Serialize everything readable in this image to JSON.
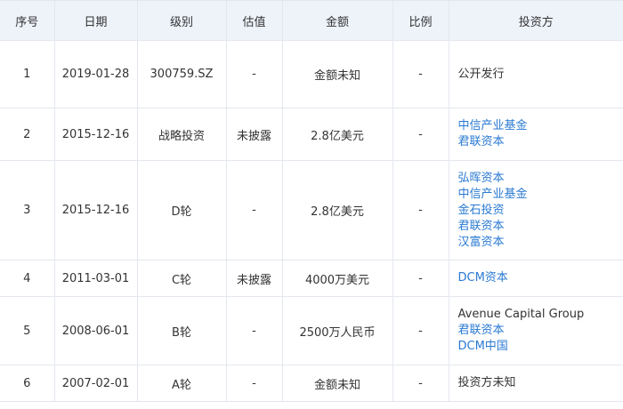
{
  "headers": [
    "序号",
    "日期",
    "级别",
    "估值",
    "金额",
    "比例",
    "投资方"
  ],
  "rows": [
    {
      "no": "1",
      "date": "2019-01-28",
      "level": "300759.SZ",
      "valuation": "-",
      "amount": "金额未知",
      "ratio": "-",
      "investors": [
        {
          "name": "公开发行",
          "link": false
        }
      ]
    },
    {
      "no": "2",
      "date": "2015-12-16",
      "level": "战略投资",
      "valuation": "未披露",
      "amount": "2.8亿美元",
      "ratio": "-",
      "investors": [
        {
          "name": "中信产业基金",
          "link": true
        },
        {
          "name": "君联资本",
          "link": true
        }
      ]
    },
    {
      "no": "3",
      "date": "2015-12-16",
      "level": "D轮",
      "valuation": "-",
      "amount": "2.8亿美元",
      "ratio": "-",
      "investors": [
        {
          "name": "弘晖资本",
          "link": true
        },
        {
          "name": "中信产业基金",
          "link": true
        },
        {
          "name": "金石投资",
          "link": true
        },
        {
          "name": "君联资本",
          "link": true
        },
        {
          "name": "汉富资本",
          "link": true
        }
      ]
    },
    {
      "no": "4",
      "date": "2011-03-01",
      "level": "C轮",
      "valuation": "未披露",
      "amount": "4000万美元",
      "ratio": "-",
      "investors": [
        {
          "name": "DCM资本",
          "link": true
        }
      ]
    },
    {
      "no": "5",
      "date": "2008-06-01",
      "level": "B轮",
      "valuation": "-",
      "amount": "2500万人民币",
      "ratio": "-",
      "investors": [
        {
          "name": "Avenue Capital Group",
          "link": false
        },
        {
          "name": "君联资本",
          "link": true
        },
        {
          "name": "DCM中国",
          "link": true
        }
      ]
    },
    {
      "no": "6",
      "date": "2007-02-01",
      "level": "A轮",
      "valuation": "-",
      "amount": "金额未知",
      "ratio": "-",
      "investors": [
        {
          "name": "投资方未知",
          "link": false
        }
      ]
    }
  ],
  "colors": {
    "header_bg": "#eef3fa",
    "border": "#e3e7ee",
    "link": "#2a7ad2",
    "text": "#333333"
  }
}
